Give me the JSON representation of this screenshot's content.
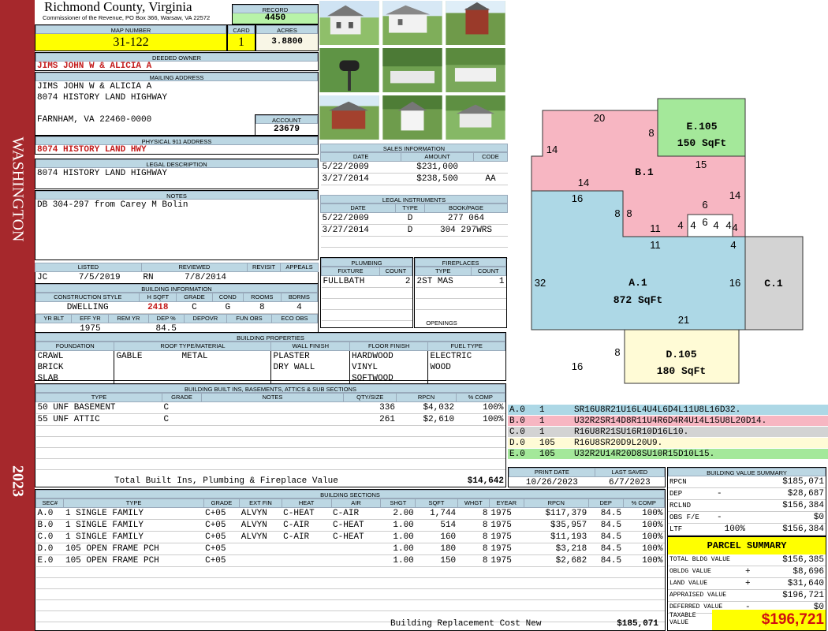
{
  "side": {
    "district": "WASHINGTON",
    "year": "2023"
  },
  "header": {
    "county": "Richmond County, Virginia",
    "subtitle": "Commissioner of the Revenue, PO Box 366, Warsaw, VA 22572",
    "record_label": "RECORD",
    "record": "4450",
    "map_label": "MAP NUMBER",
    "map": "31-122",
    "card_label": "CARD",
    "card": "1",
    "acres_label": "ACRES",
    "acres": "3.8800"
  },
  "owner": {
    "deeded_label": "DEEDED OWNER",
    "deeded": "JIMS JOHN W & ALICIA A",
    "mailing_label": "MAILING ADDRESS",
    "mailing": [
      "JIMS JOHN W & ALICIA A",
      "8074 HISTORY LAND HIGHWAY",
      "",
      "FARNHAM, VA 22460-0000"
    ],
    "account_label": "ACCOUNT",
    "account": "23679",
    "physical_label": "PHYSICAL 911 ADDRESS",
    "physical": "8074 HISTORY LAND HWY",
    "legal_label": "LEGAL DESCRIPTION",
    "legal": "8074 HISTORY LAND HIGHWAY",
    "notes_label": "NOTES",
    "notes": "DB 304-297 from Carey M Bolin"
  },
  "sales": {
    "title": "SALES INFORMATION",
    "cols": [
      "DATE",
      "AMOUNT",
      "CODE"
    ],
    "rows": [
      [
        "5/22/2009",
        "$231,000",
        ""
      ],
      [
        "3/27/2014",
        "$238,500",
        "AA"
      ]
    ]
  },
  "legal_instruments": {
    "title": "LEGAL INSTRUMENTS",
    "cols": [
      "DATE",
      "TYPE",
      "BOOK/PAGE"
    ],
    "rows": [
      [
        "5/22/2009",
        "D",
        "277 064"
      ],
      [
        "3/27/2014",
        "D",
        "304 297WRS"
      ]
    ]
  },
  "plumbing": {
    "title": "PLUMBING",
    "cols": [
      "FIXTURE",
      "COUNT"
    ],
    "rows": [
      [
        "FULLBATH",
        "2"
      ]
    ]
  },
  "fireplaces": {
    "title": "FIREPLACES",
    "cols": [
      "TYPE",
      "COUNT"
    ],
    "rows": [
      [
        "2ST MAS",
        "1"
      ]
    ],
    "openings_label": "OPENINGS"
  },
  "listing": {
    "cols": [
      "LISTED",
      "REVIEWED",
      "REVISIT",
      "APPEALS"
    ],
    "listed_by": "JC",
    "listed": "7/5/2019",
    "reviewed_by": "RN",
    "reviewed": "7/8/2014"
  },
  "building_info": {
    "title": "BUILDING INFORMATION",
    "cols": [
      "CONSTRUCTION STYLE",
      "H SQFT",
      "GRADE",
      "COND",
      "ROOMS",
      "BDRMS"
    ],
    "vals": [
      "DWELLING",
      "2418",
      "C",
      "G",
      "8",
      "4"
    ],
    "cols2": [
      "YR BLT",
      "EFF YR",
      "REM YR",
      "DEP %",
      "DEPOVR",
      "FUN OBS",
      "ECO OBS"
    ],
    "vals2": [
      "",
      "1975",
      "",
      "84.5",
      "",
      "",
      ""
    ]
  },
  "properties": {
    "title": "BUILDING PROPERTIES",
    "cols": [
      "FOUNDATION",
      "ROOF TYPE/MATERIAL",
      "WALL FINISH",
      "FLOOR FINISH",
      "FUEL TYPE"
    ],
    "foundation": [
      "CRAWL",
      "BRICK",
      "SLAB"
    ],
    "roof_type": "GABLE",
    "roof_material": "METAL",
    "wall": [
      "PLASTER",
      "DRY WALL"
    ],
    "floor": [
      "HARDWOOD",
      "VINYL",
      "SOFTWOOD"
    ],
    "fuel": [
      "ELECTRIC",
      "WOOD"
    ]
  },
  "builtins": {
    "title": "BUILDING BUILT INS, BASEMENTS, ATTICS & SUB SECTIONS",
    "cols": [
      "TYPE",
      "GRADE",
      "NOTES",
      "QTY/SIZE",
      "RPCN",
      "% COMP"
    ],
    "rows": [
      [
        "50 UNF BASEMENT",
        "C",
        "",
        "336",
        "$4,032",
        "100%"
      ],
      [
        "55 UNF ATTIC",
        "C",
        "",
        "261",
        "$2,610",
        "100%"
      ]
    ],
    "total_label": "Total Built Ins, Plumbing & Fireplace Value",
    "total": "$14,642"
  },
  "sections": {
    "title": "BUILDING SECTIONS",
    "cols": [
      "SEC#",
      "TYPE",
      "GRADE",
      "EXT FIN",
      "HEAT",
      "AIR",
      "SHGT",
      "SQFT",
      "WHGT",
      "EYEAR",
      "RPCN",
      "DEP",
      "% COMP"
    ],
    "rows": [
      [
        "A.0",
        "1 SINGLE FAMILY",
        "C+05",
        "ALVYN",
        "C-HEAT",
        "C-AIR",
        "2.00",
        "1,744",
        "8",
        "1975",
        "$117,379",
        "84.5",
        "100%"
      ],
      [
        "B.0",
        "1 SINGLE FAMILY",
        "C+05",
        "ALVYN",
        "C-AIR",
        "C-HEAT",
        "1.00",
        "514",
        "8",
        "1975",
        "$35,957",
        "84.5",
        "100%"
      ],
      [
        "C.0",
        "1 SINGLE FAMILY",
        "C+05",
        "ALVYN",
        "C-AIR",
        "C-HEAT",
        "1.00",
        "160",
        "8",
        "1975",
        "$11,193",
        "84.5",
        "100%"
      ],
      [
        "D.0",
        "105 OPEN FRAME PCH",
        "C+05",
        "",
        "",
        "",
        "1.00",
        "180",
        "8",
        "1975",
        "$3,218",
        "84.5",
        "100%"
      ],
      [
        "E.0",
        "105 OPEN FRAME PCH",
        "C+05",
        "",
        "",
        "",
        "1.00",
        "150",
        "8",
        "1975",
        "$2,682",
        "84.5",
        "100%"
      ]
    ],
    "total_label": "Building Replacement Cost New",
    "total": "$185,071"
  },
  "sketch": {
    "areas": [
      {
        "label": "A.1",
        "area": "872 SqFt",
        "color": "#add8e6"
      },
      {
        "label": "B.1",
        "area": "",
        "color": "#f7b6c2"
      },
      {
        "label": "C.1",
        "area": "",
        "color": "#d3d3d3"
      },
      {
        "label": "D.105",
        "area": "180 SqFt",
        "color": "#fffbd6"
      },
      {
        "label": "E.105",
        "area": "150 SqFt",
        "color": "#a4e89a"
      }
    ],
    "dims": [
      "20",
      "8",
      "14",
      "14",
      "15",
      "16",
      "8",
      "8",
      "6",
      "14",
      "11",
      "4",
      "4",
      "6",
      "4",
      "4",
      "4",
      "11",
      "4",
      "32",
      "16",
      "21",
      "8",
      "16"
    ]
  },
  "vectors": [
    {
      "sec": "A.0",
      "n": "1",
      "code": "SR16U8R21U16L4U4L6D4L11U8L16D32.",
      "color": "#add8e6"
    },
    {
      "sec": "B.0",
      "n": "1",
      "code": "U32R2SR14D8R11U4R6D4R4U14L15U8L20D14.",
      "color": "#f7b6c2"
    },
    {
      "sec": "C.0",
      "n": "1",
      "code": "R16U8R21SU16R10D16L10.",
      "color": "#d3d3d3"
    },
    {
      "sec": "D.0",
      "n": "105",
      "code": "R16U8SR20D9L20U9.",
      "color": "#fffbd6"
    },
    {
      "sec": "E.0",
      "n": "105",
      "code": "U32R2U14R20D8SU10R15D10L15.",
      "color": "#a4e89a"
    }
  ],
  "dates": {
    "print_label": "PRINT DATE",
    "print": "10/26/2023",
    "saved_label": "LAST SAVED",
    "saved": "6/7/2023"
  },
  "value_summary": {
    "title": "BUILDING VALUE SUMMARY",
    "rows": [
      [
        "RPCN",
        "",
        "$185,071"
      ],
      [
        "DEP",
        "-",
        "$28,687"
      ],
      [
        "RCLND",
        "",
        "$156,384"
      ],
      [
        "OBS F/E",
        "-",
        "$0"
      ],
      [
        "LTF",
        "100%",
        "$156,384"
      ]
    ]
  },
  "parcel": {
    "title": "PARCEL SUMMARY",
    "rows": [
      [
        "TOTAL BLDG VALUE",
        "",
        "$156,385"
      ],
      [
        "OBLDG VALUE",
        "+",
        "$8,696"
      ],
      [
        "LAND VALUE",
        "+",
        "$31,640"
      ],
      [
        "APPRAISED VALUE",
        "",
        "$196,721"
      ],
      [
        "DEFERRED VALUE",
        "-",
        "$0"
      ]
    ],
    "taxable_label1": "TAXABLE",
    "taxable_label2": "VALUE",
    "taxable": "$196,721"
  }
}
